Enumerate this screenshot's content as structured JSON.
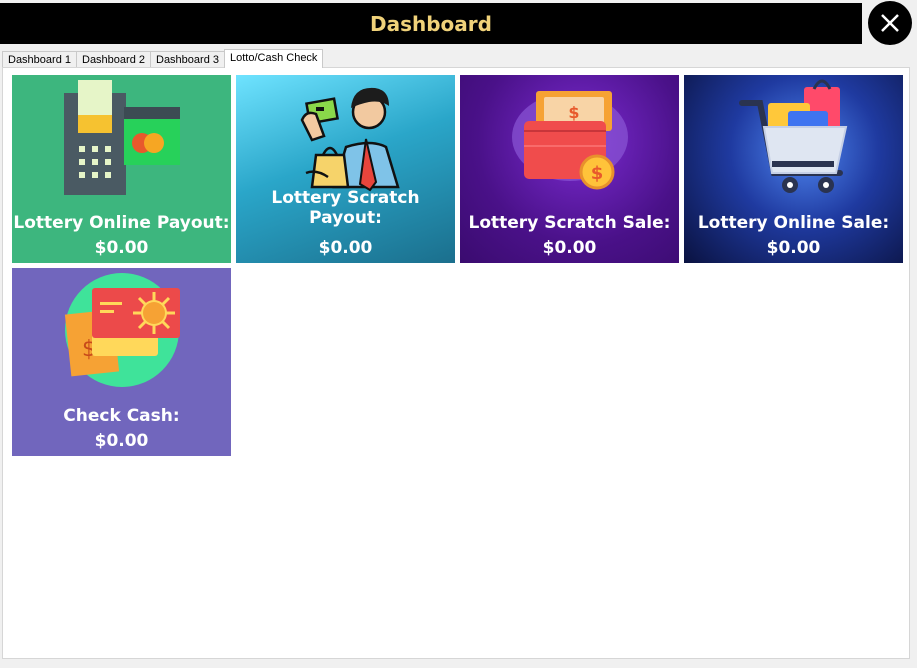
{
  "window": {
    "title": "Dashboard"
  },
  "tabs": [
    {
      "label": "Dashboard 1",
      "active": false
    },
    {
      "label": "Dashboard 2",
      "active": false
    },
    {
      "label": "Dashboard 3",
      "active": false
    },
    {
      "label": "Lotto/Cash Check",
      "active": true
    }
  ],
  "tiles": [
    {
      "label": "Lottery Online Payout:",
      "amount": "$0.00",
      "icon": "card-terminal-icon"
    },
    {
      "label": "Lottery Scratch Payout:",
      "amount": "$0.00",
      "icon": "shopper-cash-icon"
    },
    {
      "label": "Lottery Scratch Sale:",
      "amount": "$0.00",
      "icon": "wallet-money-icon"
    },
    {
      "label": "Lottery Online Sale:",
      "amount": "$0.00",
      "icon": "shopping-cart-icon"
    },
    {
      "label": "Check Cash:",
      "amount": "$0.00",
      "icon": "cash-check-icon"
    }
  ],
  "colors": {
    "title_text": "#f0d27a",
    "tile_online_payout": "#3db67e",
    "tile_check_cash": "#7166bd"
  }
}
